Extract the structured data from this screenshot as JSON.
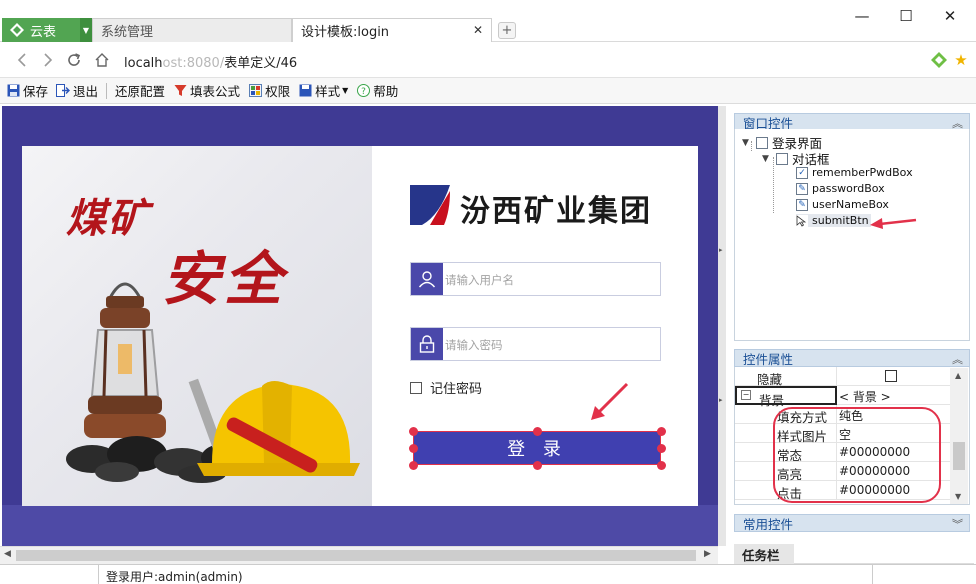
{
  "browser": {
    "app_tab": "云表",
    "tabs": [
      {
        "label": "系统管理"
      },
      {
        "label": "设计模板:login"
      }
    ],
    "url_prefix": "localh",
    "url_blurred": "ost:8080/",
    "url_path": "表单定义/46",
    "window": {
      "minimize": "—",
      "maximize": "☐",
      "close": "✕"
    }
  },
  "toolbar": {
    "save": "保存",
    "exit": "退出",
    "restore": "还原配置",
    "formula": "填表公式",
    "permission": "权限",
    "style": "样式",
    "help": "帮助"
  },
  "login_form": {
    "banner_line1": "煤矿",
    "banner_line2": "安全",
    "company": "汾西矿业集团",
    "username_placeholder": "请输入用户名",
    "password_placeholder": "请输入密码",
    "remember_label": "记住密码",
    "login_button": "登 录"
  },
  "right_panel": {
    "window_controls_title": "窗口控件",
    "tree": {
      "root": "登录界面",
      "dialog": "对话框",
      "children": [
        "rememberPwdBox",
        "passwordBox",
        "userNameBox",
        "submitBtn"
      ]
    },
    "properties_title": "控件属性",
    "properties": [
      {
        "key": "隐藏",
        "value": ""
      },
      {
        "key": "背景",
        "value": "< 背景 >"
      },
      {
        "key": "填充方式",
        "value": "纯色"
      },
      {
        "key": "样式图片",
        "value": "空"
      },
      {
        "key": "常态",
        "value": "#00000000"
      },
      {
        "key": "高亮",
        "value": "#00000000"
      },
      {
        "key": "点击",
        "value": "#00000000"
      }
    ],
    "common_controls_title": "常用控件",
    "taskbar_tab": "任务栏"
  },
  "status": {
    "user": "登录用户:admin(admin)"
  },
  "colors": {
    "app_green": "#52a552",
    "canvas_bg": "#3f3a94",
    "login_button": "#4040b0",
    "annotation_red": "#e2314a"
  }
}
